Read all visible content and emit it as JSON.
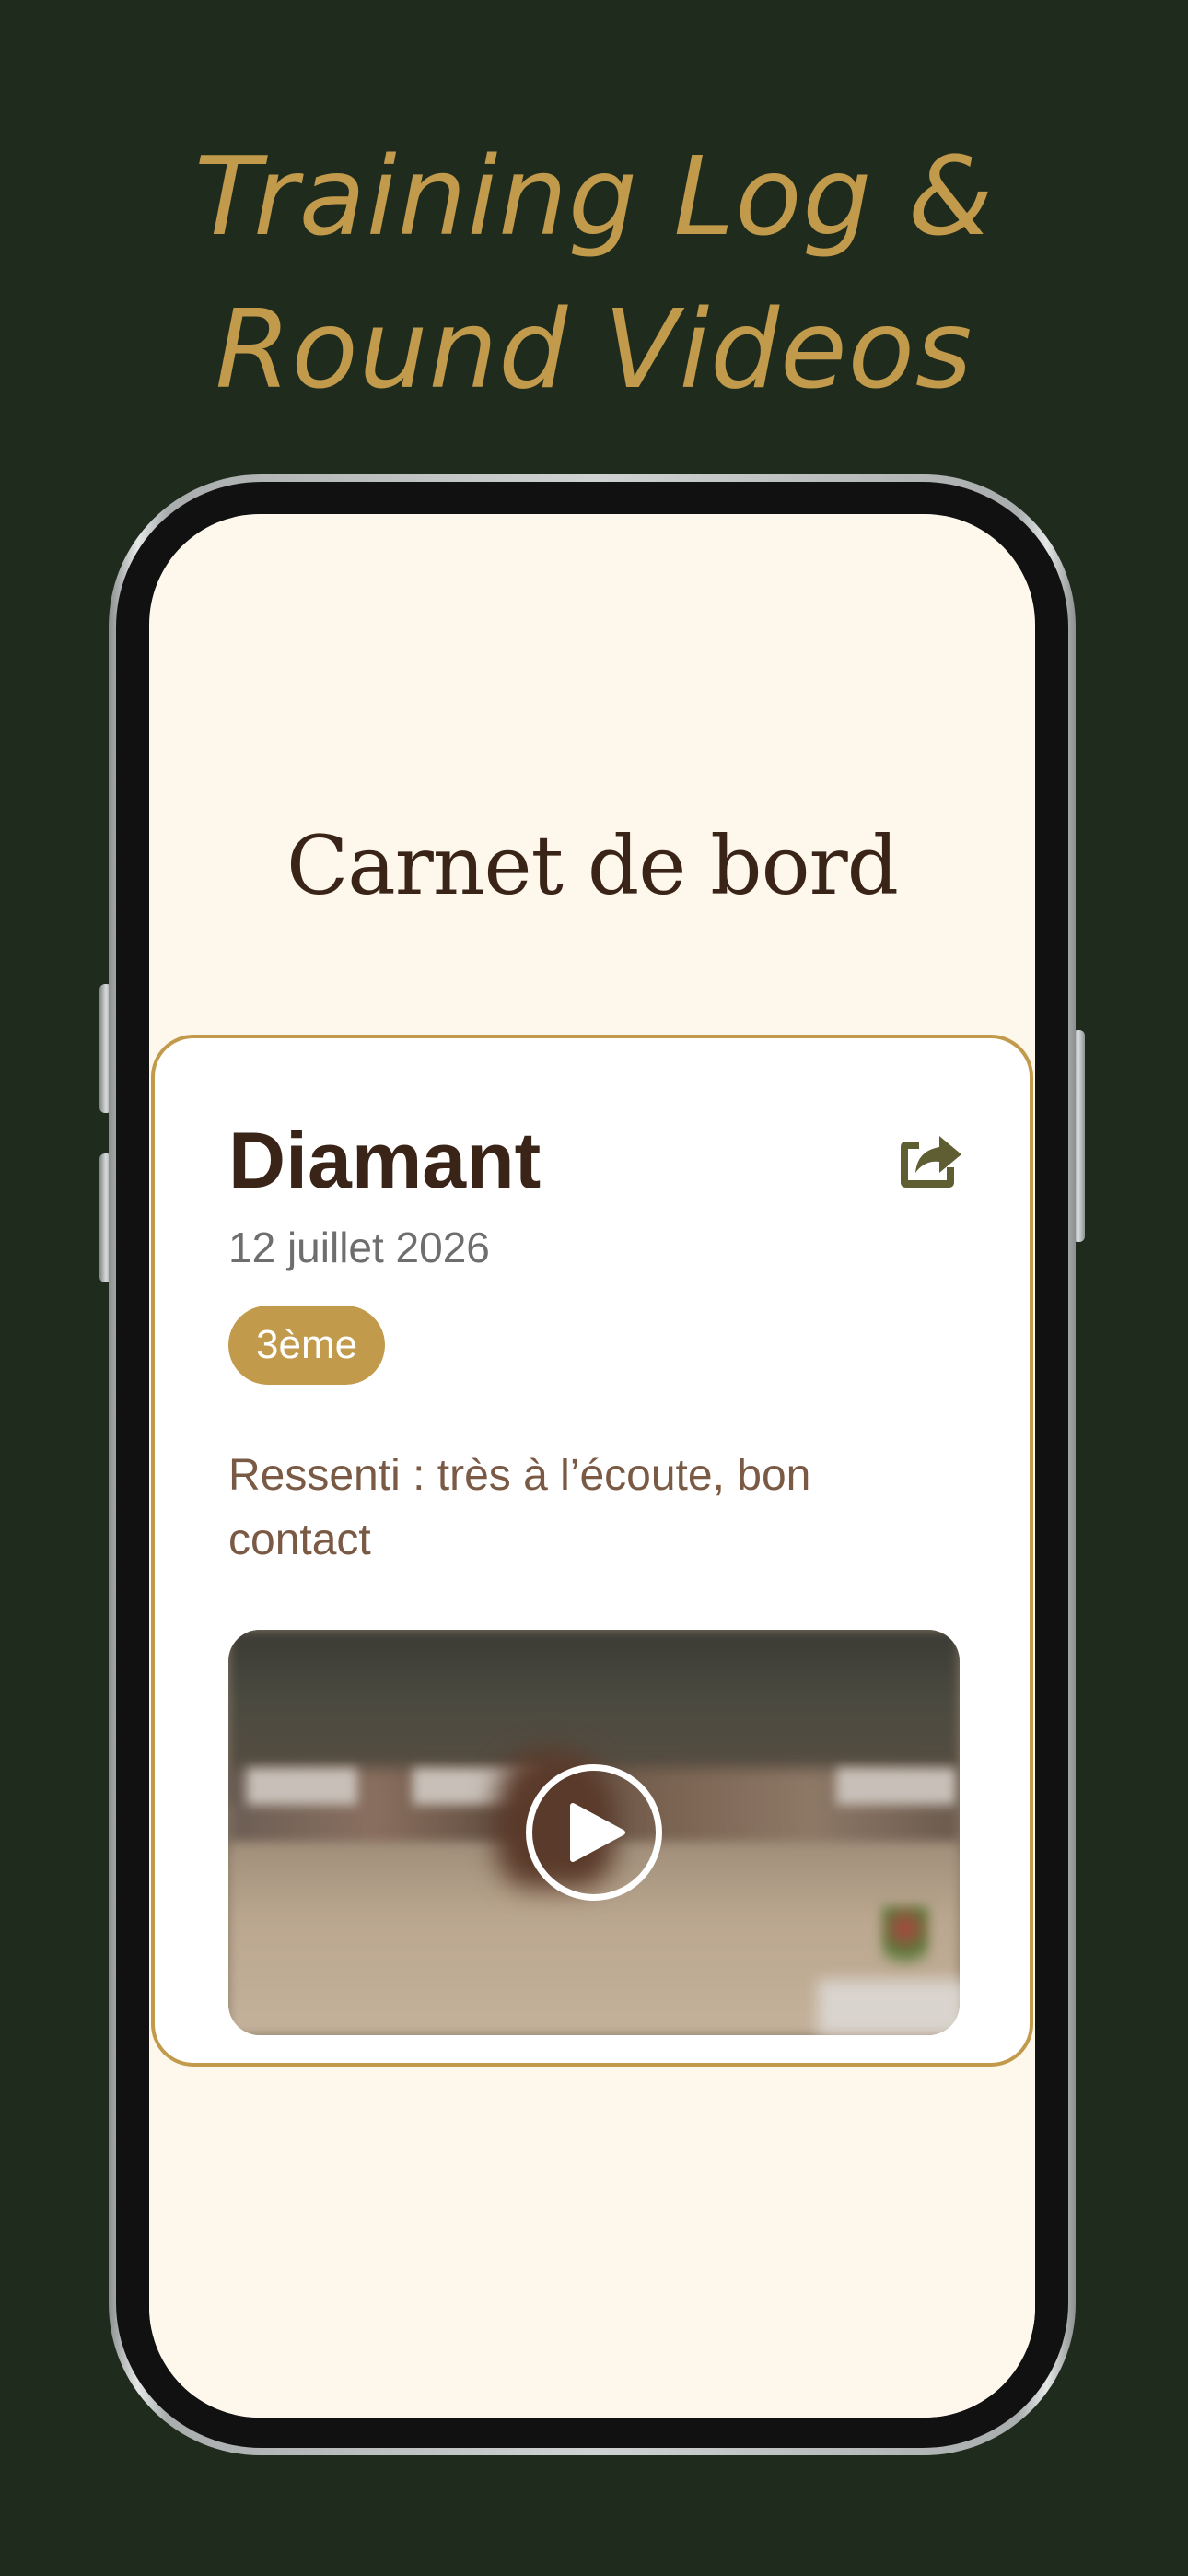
{
  "promo": {
    "headline_line1": "Training Log &",
    "headline_line2": "Round Videos"
  },
  "screen": {
    "title": "Carnet de bord"
  },
  "entry": {
    "horse_name": "Diamant",
    "date": "12 juillet 2026",
    "placing_badge": "3ème",
    "feeling": "Ressenti : très à l’écoute, bon contact",
    "share_icon": "share-icon",
    "video": {
      "thumbnail": "blurred-arena-round-video",
      "play_icon": "play-icon"
    }
  },
  "colors": {
    "background": "#1f2c1d",
    "accent_gold": "#c29a4c",
    "screen_bg": "#fdf7ec",
    "text_dark": "#3a2418",
    "text_brown": "#7a5a44",
    "share_olive": "#5f5e33"
  }
}
